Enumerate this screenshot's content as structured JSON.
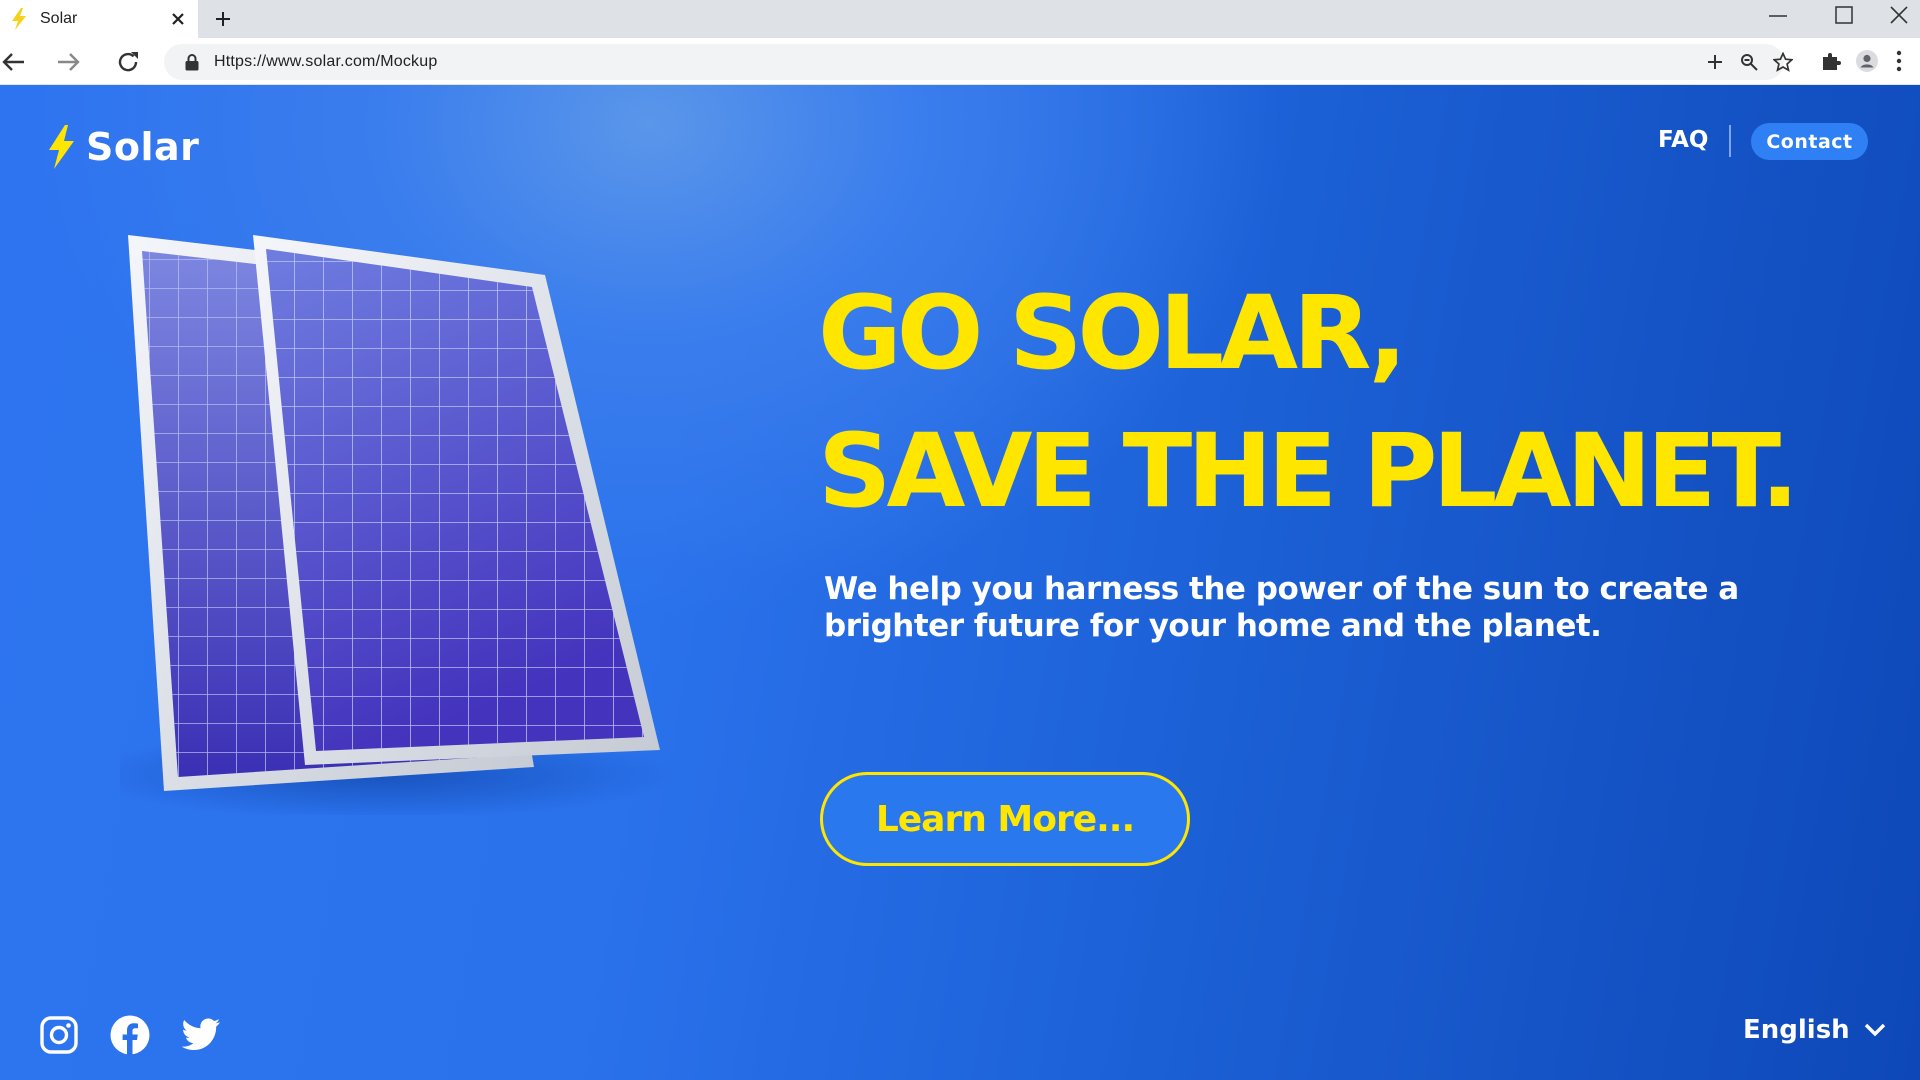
{
  "browser": {
    "tab_title": "Solar",
    "url": "Https://www.solar.com/Mockup",
    "icons": [
      "bolt-favicon",
      "close-icon",
      "plus-icon",
      "minimize-icon",
      "maximize-icon",
      "window-close-icon",
      "back-icon",
      "forward-icon",
      "reload-icon",
      "lock-icon",
      "plus-icon",
      "zoom-icon",
      "star-icon",
      "puzzle-icon",
      "profile-icon",
      "menu-icon"
    ]
  },
  "site": {
    "logo": "Solar",
    "nav": {
      "faq": "FAQ",
      "contact": "Contact"
    },
    "hero": {
      "line1": "GO SOLAR,",
      "line2": "SAVE THE PLANET.",
      "subtitle": "We help you harness the power of the sun to create a brighter future for your home and the planet.",
      "cta": "Learn More..."
    },
    "language": "English",
    "social": [
      "instagram-icon",
      "facebook-icon",
      "twitter-icon"
    ]
  },
  "colors": {
    "accent_yellow": "#FFE600",
    "contact_button": "#2F80F5",
    "background_blue": "#1E63DA"
  }
}
